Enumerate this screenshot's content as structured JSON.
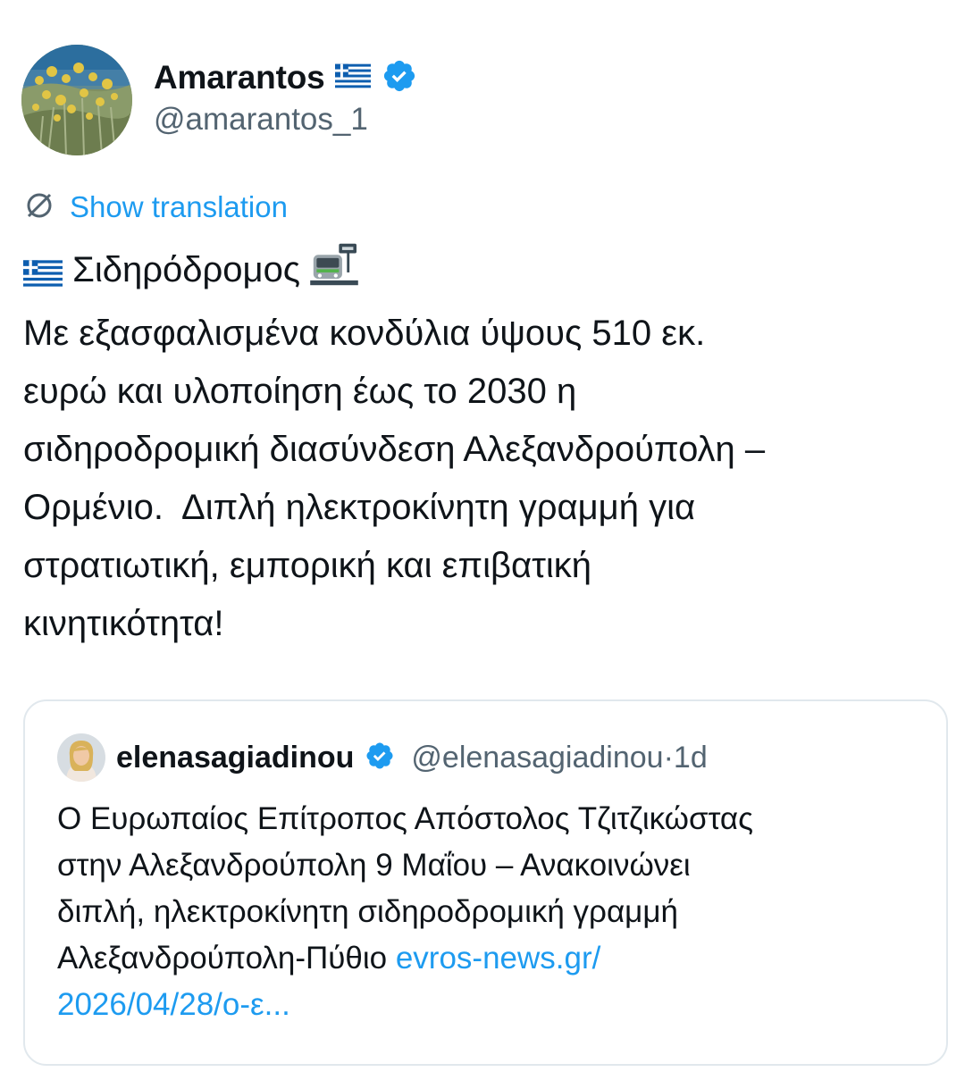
{
  "author": {
    "display_name": "Amarantos",
    "handle": "@amarantos_1",
    "verified": true,
    "flag": "greece-flag"
  },
  "translate": {
    "label": "Show translation",
    "icon": "globe-icon"
  },
  "tweet": {
    "line1": "Σιδηρόδρομος",
    "body": "Με εξασφαλισμένα κονδύλια ύψους 510 εκ.\nευρώ και υλοποίηση έως το 2030 η\nσιδηροδρομική διασύνδεση Αλεξανδρούπολη –\nΟρμένιο.  Διπλή ηλεκτροκίνητη γραμμή για\nστρατιωτική, εμπορική και επιβατική\nκινητικότητα!"
  },
  "quote": {
    "name": "elenasagiadinou",
    "handle": "@elenasagiadinou",
    "separator": "·",
    "time": "1d",
    "text": "Ο Ευρωπαίος Επίτροπος Απόστολος Τζιτζικώστας\nστην Αλεξανδρούπολη 9 Μαΐου – Ανακοινώνει\nδιπλή, ηλεκτροκίνητη σιδηροδρομική γραμμή\nΑλεξανδρούπολη-Πύθιο ",
    "link": "evros-news.gr/\n2026/04/28/ο-ε..."
  },
  "colors": {
    "accent": "#1d9bf0",
    "text": "#0f1419",
    "secondary": "#536471",
    "border": "#e1e8ed"
  }
}
